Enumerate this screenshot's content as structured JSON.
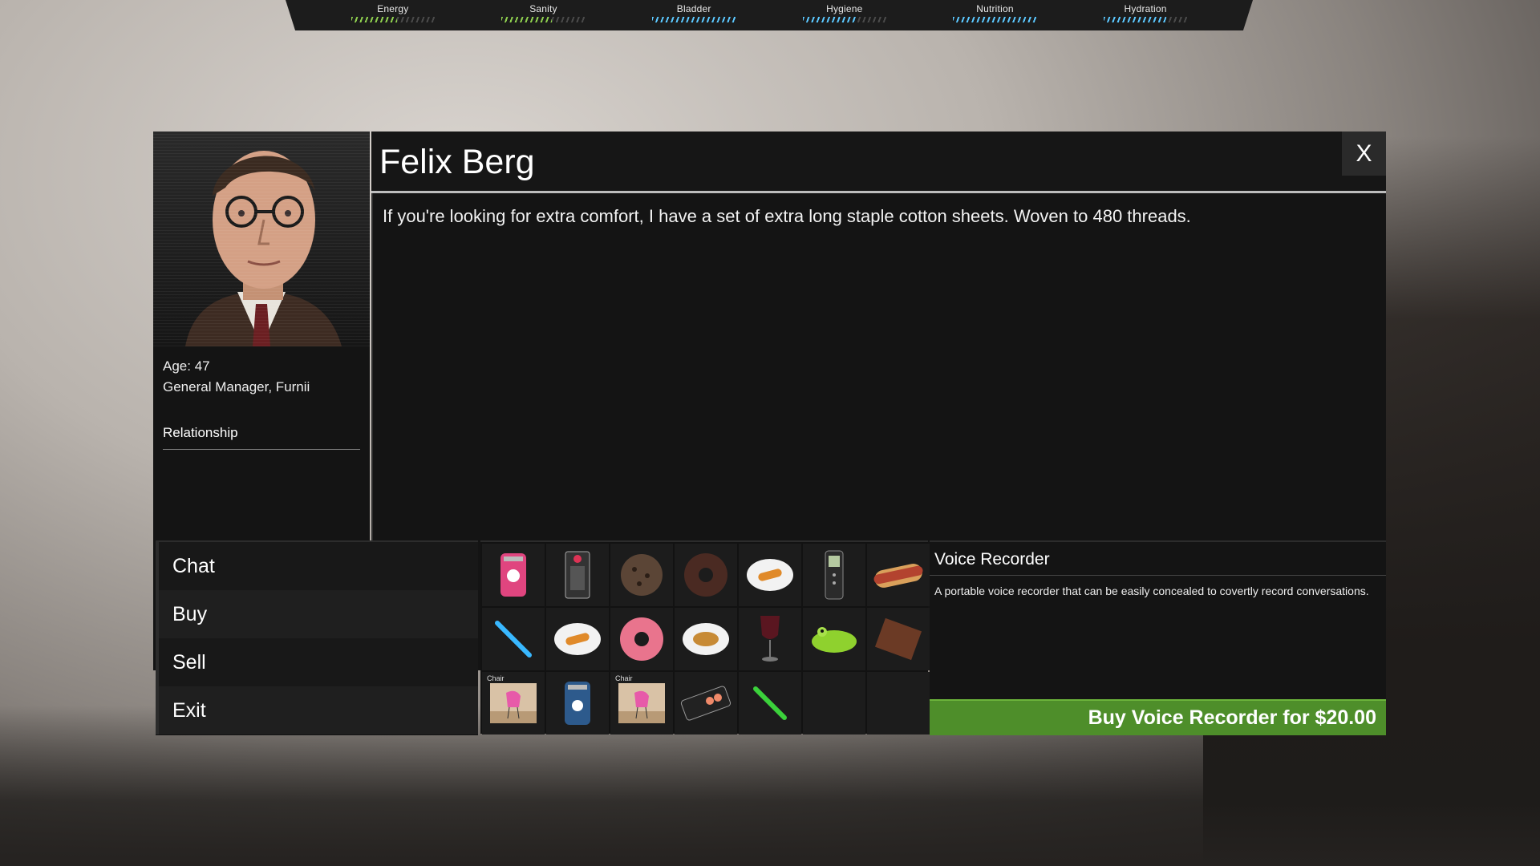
{
  "hud": {
    "stats": [
      {
        "label": "Energy",
        "level": 0.55,
        "color": "#8fd14f"
      },
      {
        "label": "Sanity",
        "level": 0.6,
        "color": "#8fd14f"
      },
      {
        "label": "Bladder",
        "level": 1.0,
        "color": "#5bc8ff"
      },
      {
        "label": "Hygiene",
        "level": 0.65,
        "color": "#5bc8ff"
      },
      {
        "label": "Nutrition",
        "level": 1.0,
        "color": "#5bc8ff"
      },
      {
        "label": "Hydration",
        "level": 0.75,
        "color": "#5bc8ff"
      }
    ]
  },
  "npc": {
    "name": "Felix Berg",
    "age": "Age: 47",
    "job": "General Manager, Furnii",
    "relationship_label": "Relationship",
    "speech": "If you're looking for extra comfort, I have a set of extra long staple cotton sheets. Woven to 480 threads."
  },
  "close_label": "X",
  "menu": [
    "Chat",
    "Buy",
    "Sell",
    "Exit"
  ],
  "items": [
    {
      "icon": "soda-can-pink-icon"
    },
    {
      "icon": "phone-case-icon"
    },
    {
      "icon": "cookie-icon"
    },
    {
      "icon": "chocolate-donut-icon"
    },
    {
      "icon": "churro-plate-icon"
    },
    {
      "icon": "voice-recorder-icon"
    },
    {
      "icon": "hotdog-icon"
    },
    {
      "icon": "blue-glowstick-icon"
    },
    {
      "icon": "churro-plate-icon"
    },
    {
      "icon": "pink-donut-icon"
    },
    {
      "icon": "fries-plate-icon"
    },
    {
      "icon": "wine-glass-icon"
    },
    {
      "icon": "toy-crocodile-icon"
    },
    {
      "icon": "pizza-slice-icon"
    },
    {
      "icon": "pink-chair-icon",
      "tag": "Chair"
    },
    {
      "icon": "soda-can-blue-icon"
    },
    {
      "icon": "pink-chair-icon",
      "tag": "Chair"
    },
    {
      "icon": "sushi-pack-icon"
    },
    {
      "icon": "green-glowstick-icon"
    },
    {
      "icon": "empty-slot"
    },
    {
      "icon": "empty-slot"
    }
  ],
  "detail": {
    "title": "Voice Recorder",
    "description": "A portable voice recorder that can be easily concealed to covertly record conversations.",
    "buy_label": "Buy Voice Recorder for $20.00"
  }
}
